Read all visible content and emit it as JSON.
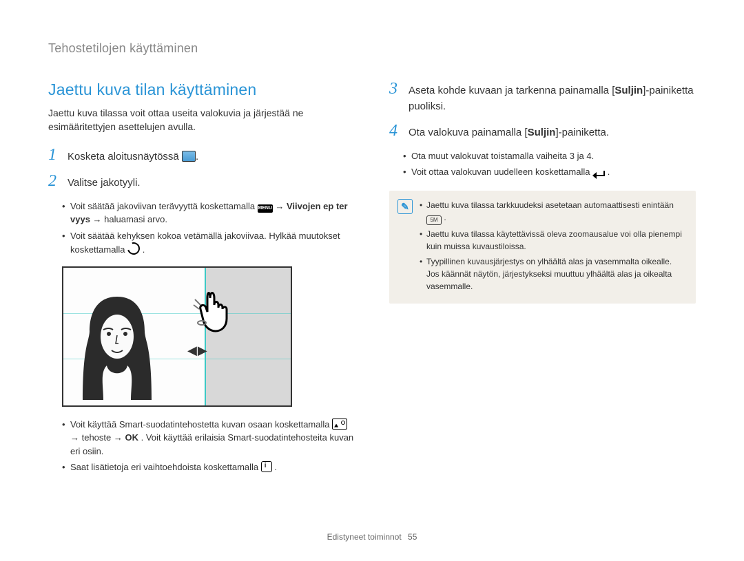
{
  "breadcrumb": "Tehostetilojen käyttäminen",
  "left": {
    "title": "Jaettu kuva tilan käyttäminen",
    "intro": "Jaettu kuva tilassa voit ottaa useita valokuvia ja järjestää ne esimääritettyjen asettelujen avulla.",
    "step1_num": "1",
    "step1_text": "Kosketa aloitusnäytössä ",
    "step2_num": "2",
    "step2_text": "Valitse jakotyyli.",
    "step2_sub1_a": "Voit säätää jakoviivan terävyyttä koskettamalla ",
    "step2_sub1_b": " → ",
    "step2_sub1_c": "Viivojen ep ter vyys",
    "step2_sub1_d": " → haluamasi arvo.",
    "step2_sub2_a": "Voit säätää kehyksen kokoa vetämällä jakoviivaa. Hylkää muutokset koskettamalla ",
    "step2_sub2_b": ".",
    "step2_sub3_a": "Voit käyttää Smart-suodatintehostetta kuvan osaan koskettamalla ",
    "step2_sub3_b": " → tehoste → ",
    "step2_sub3_c": ". Voit käyttää erilaisia Smart-suodatintehosteita kuvan eri osiin.",
    "step2_sub4_a": "Saat lisätietoja eri vaihtoehdoista koskettamalla ",
    "step2_sub4_b": ".",
    "menu_label": "MENU",
    "ok_label": "OK"
  },
  "right": {
    "step3_num": "3",
    "step3_a": "Aseta kohde kuvaan ja tarkenna painamalla [",
    "step3_b": "Suljin",
    "step3_c": "]-painiketta puoliksi.",
    "step4_num": "4",
    "step4_a": "Ota valokuva painamalla [",
    "step4_b": "Suljin",
    "step4_c": "]-painiketta.",
    "step4_sub1": "Ota muut valokuvat toistamalla vaiheita 3 ja 4.",
    "step4_sub2_a": "Voit ottaa valokuvan uudelleen koskettamalla ",
    "step4_sub2_b": ".",
    "note1_a": "Jaettu kuva tilassa tarkkuudeksi asetetaan automaattisesti enintään ",
    "note1_badge": "5M",
    "note1_b": ".",
    "note2": "Jaettu kuva tilassa käytettävissä oleva zoomausalue voi olla pienempi kuin muissa kuvaustiloissa.",
    "note3": "Tyypillinen kuvausjärjestys on ylhäältä alas ja vasemmalta oikealle. Jos käännät näytön, järjestykseksi muuttuu ylhäältä alas ja oikealta vasemmalle."
  },
  "illus_arrows": "◀ ▶",
  "footer_label": "Edistyneet toiminnot",
  "footer_page": "55"
}
